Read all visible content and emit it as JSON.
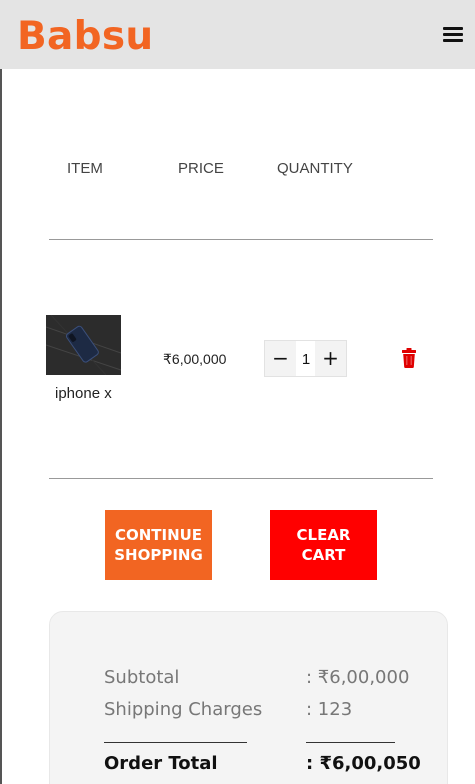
{
  "app": {
    "brand": "Babsu"
  },
  "header": {
    "menu_icon": "hamburger-menu-icon"
  },
  "cart_table": {
    "columns": [
      "ITEM",
      "PRICE",
      "QUANTITY"
    ],
    "items": [
      {
        "name": "iphone x",
        "price": "₹6,00,000",
        "quantity": "1",
        "decrement_label": "−",
        "increment_label": "+",
        "delete_icon": "trash-icon"
      }
    ]
  },
  "actions": {
    "continue_label": "CONTINUE SHOPPING",
    "clear_label": "CLEAR CART"
  },
  "summary": {
    "subtotal_label": "Subtotal",
    "subtotal_value": ": ₹6,00,000",
    "shipping_label": "Shipping Charges",
    "shipping_value": ": 123",
    "total_label": "Order Total",
    "total_value": ": ₹6,00,050"
  },
  "colors": {
    "brand": "#f26522",
    "danger": "#ff0000",
    "header_bg": "#e4e4e4",
    "summary_bg": "#f4f4f4"
  }
}
